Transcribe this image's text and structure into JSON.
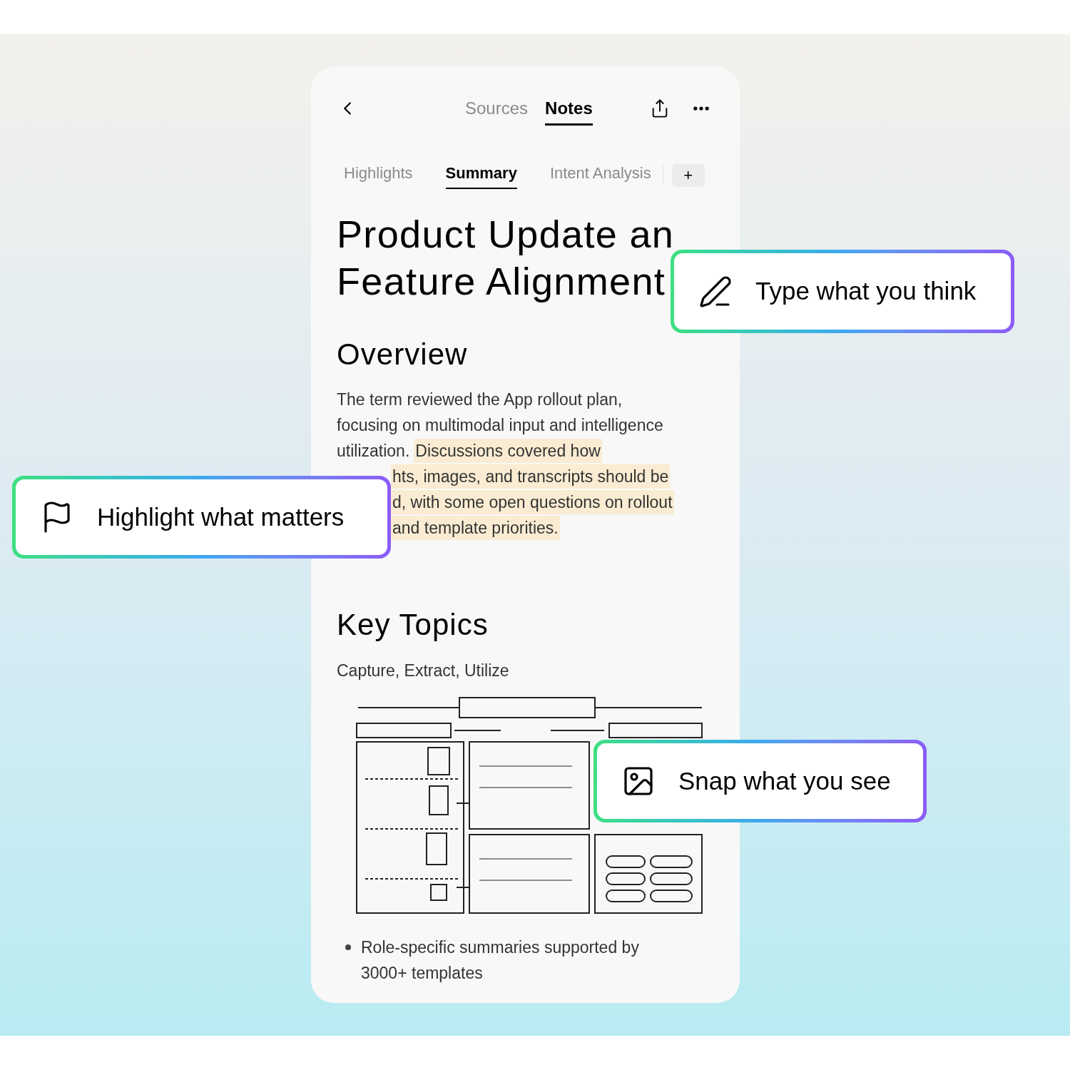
{
  "top_bar": {
    "tabs": [
      {
        "label": "Sources",
        "selected": false
      },
      {
        "label": "Notes",
        "selected": true
      }
    ]
  },
  "note_tabs": [
    {
      "label": "Highlights",
      "selected": false
    },
    {
      "label": "Summary",
      "selected": true
    },
    {
      "label": "Intent Analysis",
      "selected": false
    }
  ],
  "add_tab": "+",
  "title_lines": [
    "Product Update an",
    "Feature Alignment"
  ],
  "overview": {
    "heading": "Overview",
    "lines": [
      [
        {
          "text": "The term reviewed the App rollout plan,",
          "highlighted": false
        }
      ],
      [
        {
          "text": "focusing on multimodal input and intelligence",
          "highlighted": false
        }
      ],
      [
        {
          "text": "utilization.",
          "highlighted": false
        },
        {
          "text": "Discussions covered how",
          "highlighted": true
        }
      ],
      [
        {
          "text": "hts, images, and transcripts should be",
          "highlighted": true
        }
      ],
      [
        {
          "text": "d, with some open questions on rollout",
          "highlighted": true
        }
      ],
      [
        {
          "text": "and template priorities.",
          "highlighted": true
        }
      ]
    ]
  },
  "key_topics": {
    "heading": "Key Topics",
    "subtitle": "Capture, Extract, Utilize",
    "bullets": [
      "Role-specific summaries supported by 3000+ templates"
    ]
  },
  "callouts": [
    {
      "kind": "type",
      "text": "Type what you think"
    },
    {
      "kind": "highlight",
      "text": "Highlight what matters"
    },
    {
      "kind": "snap",
      "text": "Snap what you see"
    }
  ]
}
